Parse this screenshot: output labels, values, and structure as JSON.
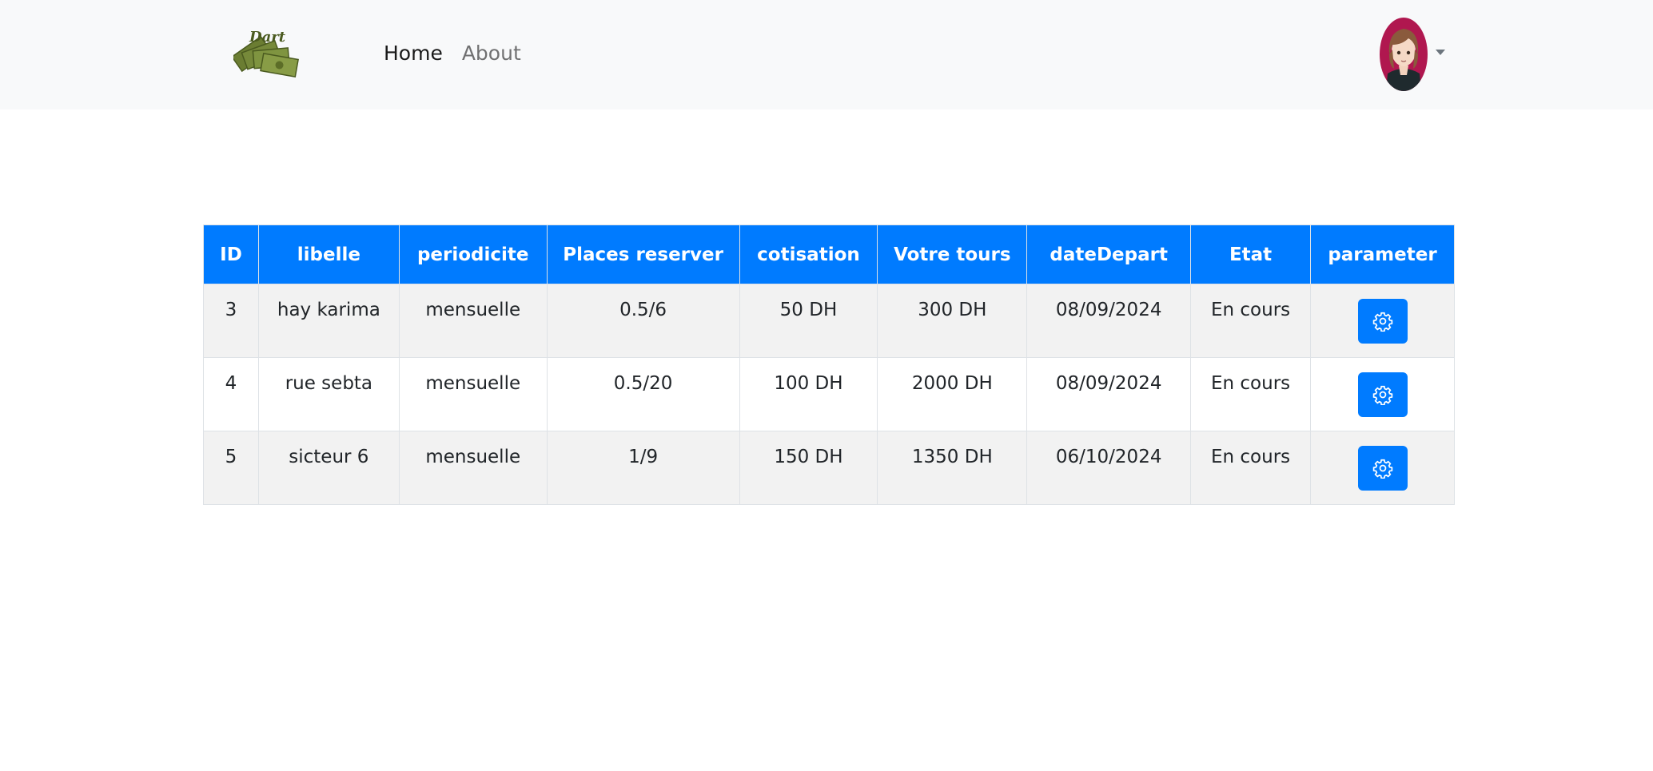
{
  "navbar": {
    "logo_text": "Dart",
    "links": [
      {
        "label": "Home",
        "active": true
      },
      {
        "label": "About",
        "active": false
      }
    ]
  },
  "colors": {
    "primary": "#007bff",
    "navbar_bg": "#f8f9fa",
    "stripe": "#f2f2f2"
  },
  "table": {
    "headers": [
      "ID",
      "libelle",
      "periodicite",
      "Places reserver",
      "cotisation",
      "Votre tours",
      "dateDepart",
      "Etat",
      "parameter"
    ],
    "rows": [
      {
        "id": "3",
        "libelle": "hay karima",
        "periodicite": "mensuelle",
        "places": "0.5/6",
        "cotisation": "50 DH",
        "tours": "300 DH",
        "date": "08/09/2024",
        "etat": "En cours",
        "icon": "gear-icon"
      },
      {
        "id": "4",
        "libelle": "rue sebta",
        "periodicite": "mensuelle",
        "places": "0.5/20",
        "cotisation": "100 DH",
        "tours": "2000 DH",
        "date": "08/09/2024",
        "etat": "En cours",
        "icon": "gear-icon"
      },
      {
        "id": "5",
        "libelle": "sicteur 6",
        "periodicite": "mensuelle",
        "places": "1/9",
        "cotisation": "150 DH",
        "tours": "1350 DH",
        "date": "06/10/2024",
        "etat": "En cours",
        "icon": "gear-icon"
      }
    ]
  }
}
